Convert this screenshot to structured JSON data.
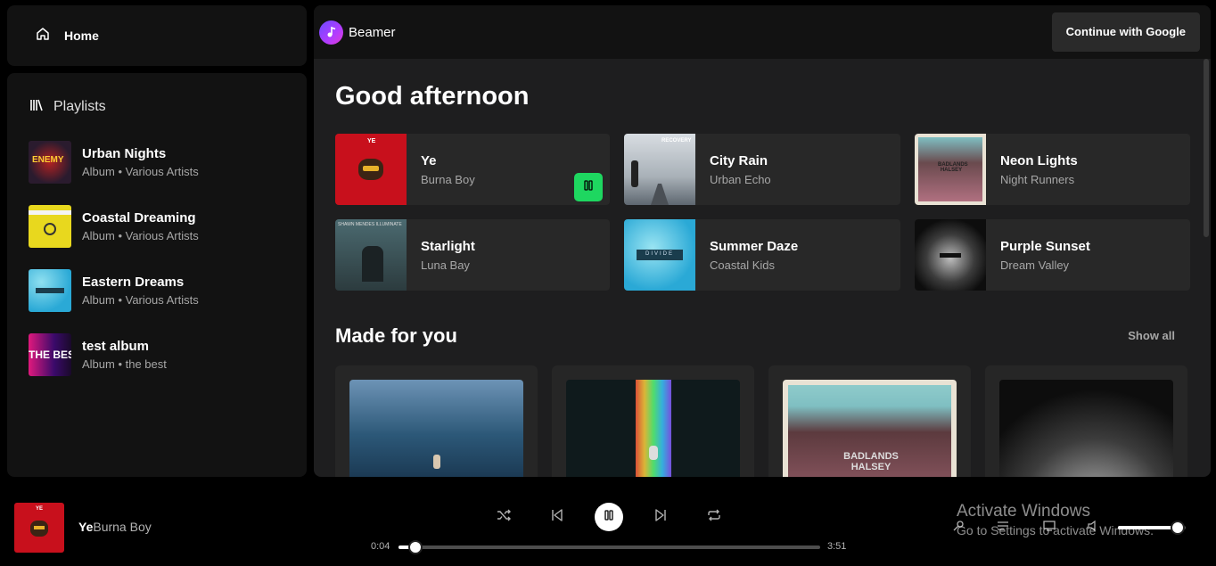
{
  "sidebar": {
    "home_label": "Home",
    "library_label": "Playlists",
    "playlists": [
      {
        "title": "Urban Nights",
        "subtitle": "Album • Various Artists",
        "cover_text": "ENEMY"
      },
      {
        "title": "Coastal Dreaming",
        "subtitle": "Album • Various Artists",
        "cover_text": ""
      },
      {
        "title": "Eastern Dreams",
        "subtitle": "Album • Various Artists",
        "cover_text": ""
      },
      {
        "title": "test album",
        "subtitle": "Album • the best",
        "cover_text": "THE BEST"
      }
    ]
  },
  "header": {
    "brand": "Beamer",
    "login_label": "Continue with Google"
  },
  "main": {
    "greeting": "Good afternoon",
    "quick_items": [
      {
        "title": "Ye",
        "subtitle": "Burna Boy",
        "cover_text": "YE"
      },
      {
        "title": "City Rain",
        "subtitle": "Urban Echo",
        "cover_text": "RECOVERY"
      },
      {
        "title": "Neon Lights",
        "subtitle": "Night Runners",
        "cover_text": "BADLANDS HALSEY"
      },
      {
        "title": "Starlight",
        "subtitle": "Luna Bay",
        "cover_text": "SHAWN MENDES ILLUMINATE"
      },
      {
        "title": "Summer Daze",
        "subtitle": "Coastal Kids",
        "cover_text": "DIVIDE"
      },
      {
        "title": "Purple Sunset",
        "subtitle": "Dream Valley",
        "cover_text": ""
      }
    ],
    "made_for_you_title": "Made for you",
    "show_all_label": "Show all",
    "made_for_you_cover_texts": [
      "",
      "",
      "BADLANDS HALSEY",
      ""
    ]
  },
  "player": {
    "now_playing_title": "Ye",
    "now_playing_artist": "Burna Boy",
    "now_playing_cover_text": "YE",
    "current_time": "0:04",
    "duration": "3:51",
    "progress_fraction": 0.035,
    "volume_fraction": 0.88
  },
  "watermark": {
    "line1": "Activate Windows",
    "line2": "Go to Settings to activate Windows."
  },
  "colors": {
    "accent_green": "#1ed760",
    "panel": "#121212",
    "main_bg": "#1e1e1f",
    "card": "#282828"
  },
  "icons": [
    "home-icon",
    "library-icon",
    "music-note-icon",
    "pause-icon",
    "shuffle-icon",
    "previous-icon",
    "next-icon",
    "repeat-icon",
    "mic-icon",
    "queue-icon",
    "device-icon",
    "volume-icon"
  ]
}
